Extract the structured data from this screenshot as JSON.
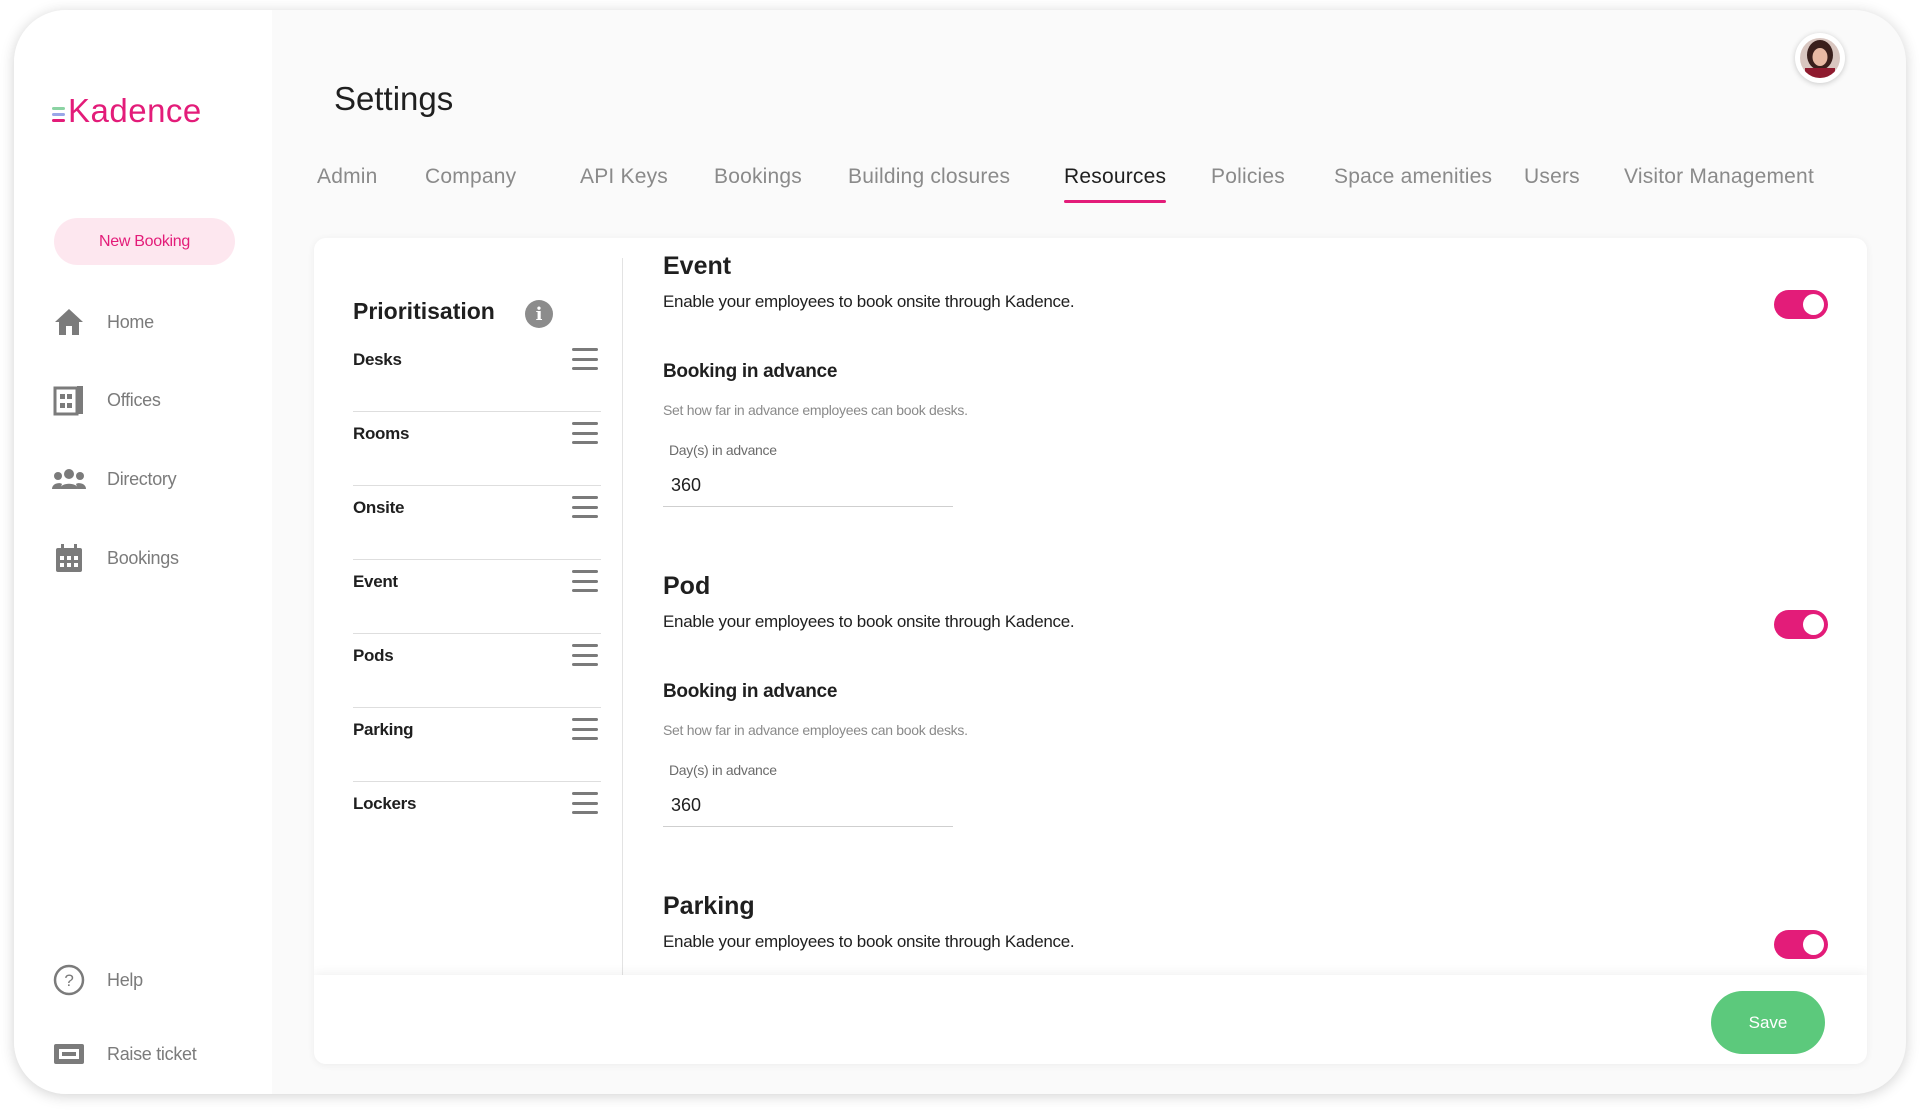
{
  "app": {
    "logo_text": "Kadence",
    "brand_color": "#e31c79",
    "logo_line_colors": [
      "#8bd3a3",
      "#9aa6e8",
      "#e31c79"
    ]
  },
  "sidebar": {
    "new_booking_label": "New Booking",
    "items": [
      {
        "label": "Home",
        "icon": "home-icon"
      },
      {
        "label": "Offices",
        "icon": "office-icon"
      },
      {
        "label": "Directory",
        "icon": "people-icon"
      },
      {
        "label": "Bookings",
        "icon": "calendar-icon"
      }
    ],
    "footer_items": [
      {
        "label": "Help",
        "icon": "help-icon"
      },
      {
        "label": "Raise ticket",
        "icon": "ticket-icon"
      }
    ]
  },
  "header": {
    "title": "Settings"
  },
  "tabs": [
    {
      "label": "Admin",
      "active": false
    },
    {
      "label": "Company",
      "active": false
    },
    {
      "label": "API Keys",
      "active": false
    },
    {
      "label": "Bookings",
      "active": false
    },
    {
      "label": "Building closures",
      "active": false
    },
    {
      "label": "Resources",
      "active": true
    },
    {
      "label": "Policies",
      "active": false
    },
    {
      "label": "Space amenities",
      "active": false
    },
    {
      "label": "Users",
      "active": false
    },
    {
      "label": "Visitor Management",
      "active": false
    }
  ],
  "prioritisation": {
    "title": "Prioritisation",
    "items": [
      "Desks",
      "Rooms",
      "Onsite",
      "Event",
      "Pods",
      "Parking",
      "Lockers"
    ]
  },
  "sections": [
    {
      "title": "Event",
      "description": "Enable your employees to book onsite through Kadence.",
      "enabled": true,
      "advance_title": "Booking in advance",
      "advance_description": "Set how far in advance employees can book desks.",
      "field_label": "Day(s) in advance",
      "field_value": "360"
    },
    {
      "title": "Pod",
      "description": "Enable your employees to book onsite through Kadence.",
      "enabled": true,
      "advance_title": "Booking in advance",
      "advance_description": "Set how far in advance employees can book desks.",
      "field_label": "Day(s) in advance",
      "field_value": "360"
    },
    {
      "title": "Parking",
      "description": "Enable your employees to book onsite through Kadence.",
      "enabled": true
    }
  ],
  "footer": {
    "save_label": "Save",
    "save_color": "#5cc97c"
  }
}
